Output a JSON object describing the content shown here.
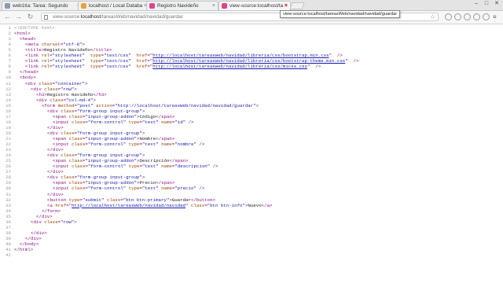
{
  "tabs": [
    {
      "title": "web1tia: Tarea: Segundo",
      "fav_color": "#8e9aa8"
    },
    {
      "title": "localhost / Local Databa",
      "fav_color": "#e8a33c"
    },
    {
      "title": "Registro Navideño",
      "fav_color": "#e0438e"
    },
    {
      "title": "view-source:localhost/ta",
      "fav_color": "#e0438e"
    }
  ],
  "tooltip": "view-source:localhost/tareasWeb/navidad/navidad/guardar",
  "omnibox": {
    "scheme": "view-source:",
    "host": "localhost",
    "path": "/tareasWeb/navidad/navidad/guardar"
  },
  "source_lines": [
    {
      "n": "1",
      "indent": 0,
      "html": "<span class=\"comment\">&lt;!DOCTYPE html&gt;</span>"
    },
    {
      "n": "2",
      "indent": 0,
      "html": "<span class=\"tag\">&lt;html&gt;</span>"
    },
    {
      "n": "3",
      "indent": 1,
      "html": "<span class=\"tag\">&lt;head&gt;</span>"
    },
    {
      "n": "4",
      "indent": 2,
      "html": "<span class=\"tag\">&lt;meta <span class=\"attr\">charset</span>=<span class=\"val\">\"utf-8\"</span>&gt;</span>"
    },
    {
      "n": "5",
      "indent": 2,
      "html": "<span class=\"tag\">&lt;title&gt;</span>Registro Navideño<span class=\"tag\">&lt;/title&gt;</span>"
    },
    {
      "n": "6",
      "indent": 2,
      "html": "<span class=\"tag\">&lt;link <span class=\"attr\">rel</span>=<span class=\"val\">\"stylesheet\"</span>  <span class=\"attr\">type</span>=<span class=\"val\">\"text/css\"</span>  <span class=\"attr\">href</span>=\"<span class=\"link\">http://localhost/tareasWeb/navidad/libreria/css/bootstrap.min.css</span>\"  /&gt;</span>"
    },
    {
      "n": "7",
      "indent": 2,
      "html": "<span class=\"tag\">&lt;link <span class=\"attr\">rel</span>=<span class=\"val\">\"stylesheet\"</span>  <span class=\"attr\">type</span>=<span class=\"val\">\"text/css\"</span>  <span class=\"attr\">href</span>=\"<span class=\"link\">http://localhost/tareasWeb/navidad/libreria/css/bootstrap-theme.min.css</span>\"  /&gt;</span>"
    },
    {
      "n": "8",
      "indent": 2,
      "html": "<span class=\"tag\">&lt;link <span class=\"attr\">rel</span>=<span class=\"val\">\"stylesheet\"</span>  <span class=\"attr\">type</span>=<span class=\"val\">\"text/css\"</span>  <span class=\"attr\">href</span>=\"<span class=\"link\">http://localhost/tareasWeb/navidad/libreria/css/micss.css</span>\"  /&gt;</span>"
    },
    {
      "n": "9",
      "indent": 1,
      "html": "<span class=\"tag\">&lt;/head&gt;</span>"
    },
    {
      "n": "10",
      "indent": 1,
      "html": "<span class=\"tag\">&lt;body&gt;</span>"
    },
    {
      "n": "11",
      "indent": 2,
      "html": "<span class=\"tag\">&lt;div <span class=\"attr\">class</span>=<span class=\"val\">\"container\"</span>&gt;</span>"
    },
    {
      "n": "12",
      "indent": 3,
      "html": "<span class=\"tag\">&lt;div <span class=\"attr\">class</span>=<span class=\"val\">\"row\"</span>&gt;</span>"
    },
    {
      "n": "13",
      "indent": 4,
      "html": "<span class=\"tag\">&lt;h3&gt;</span>Registro Navideño<span class=\"tag\">&lt;/h3&gt;</span>"
    },
    {
      "n": "14",
      "indent": 4,
      "html": "<span class=\"tag\">&lt;div <span class=\"attr\">class</span>=<span class=\"val\">\"col-md-4\"</span>&gt;</span>"
    },
    {
      "n": "15",
      "indent": 5,
      "html": "<span class=\"tag\">&lt;form <span class=\"attr\">method</span>=<span class=\"val\">\"post\"</span> <span class=\"attr\">action</span>=<span class=\"val\">\"http://localhost/tareasWeb/navidad/navidad/guardar\"</span>&gt;</span>"
    },
    {
      "n": "16",
      "indent": 6,
      "html": "<span class=\"tag\">&lt;div <span class=\"attr\">class</span>=<span class=\"val\">\"form-group input-group\"</span>&gt;</span>"
    },
    {
      "n": "17",
      "indent": 7,
      "html": "<span class=\"tag\">&lt;span <span class=\"attr\">class</span>=<span class=\"val\">\"input-group-addon\"</span>&gt;</span>Código<span class=\"tag\">&lt;/span&gt;</span>"
    },
    {
      "n": "18",
      "indent": 7,
      "html": "<span class=\"tag\">&lt;input <span class=\"attr\">class</span>=<span class=\"val\">\"form-control\"</span> <span class=\"attr\">type</span>=<span class=\"val\">\"text\"</span> <span class=\"attr\">name</span>=<span class=\"val\">\"id\"</span> /&gt;</span>"
    },
    {
      "n": "19",
      "indent": 6,
      "html": "<span class=\"tag\">&lt;/div&gt;</span>"
    },
    {
      "n": "20",
      "indent": 6,
      "html": "<span class=\"tag\">&lt;div <span class=\"attr\">class</span>=<span class=\"val\">\"form-group input-group\"</span>&gt;</span>"
    },
    {
      "n": "21",
      "indent": 7,
      "html": "<span class=\"tag\">&lt;span <span class=\"attr\">class</span>=<span class=\"val\">\"input-group-addon\"</span>&gt;</span>Nombre<span class=\"tag\">&lt;/span&gt;</span>"
    },
    {
      "n": "22",
      "indent": 7,
      "html": "<span class=\"tag\">&lt;input <span class=\"attr\">class</span>=<span class=\"val\">\"form-control\"</span> <span class=\"attr\">type</span>=<span class=\"val\">\"text\"</span> <span class=\"attr\">name</span>=<span class=\"val\">\"nombre\"</span> /&gt;</span>"
    },
    {
      "n": "23",
      "indent": 6,
      "html": "<span class=\"tag\">&lt;/div&gt;</span>"
    },
    {
      "n": "24",
      "indent": 6,
      "html": "<span class=\"tag\">&lt;div <span class=\"attr\">class</span>=<span class=\"val\">\"form-group input-group\"</span>&gt;</span>"
    },
    {
      "n": "25",
      "indent": 7,
      "html": "<span class=\"tag\">&lt;span <span class=\"attr\">class</span>=<span class=\"val\">\"input-group-addon\"</span>&gt;</span>Descripción<span class=\"tag\">&lt;/span&gt;</span>"
    },
    {
      "n": "26",
      "indent": 7,
      "html": "<span class=\"tag\">&lt;input <span class=\"attr\">class</span>=<span class=\"val\">\"form-control\"</span> <span class=\"attr\">type</span>=<span class=\"val\">\"text\"</span> <span class=\"attr\">name</span>=<span class=\"val\">\"descripcion\"</span> /&gt;</span>"
    },
    {
      "n": "27",
      "indent": 6,
      "html": "<span class=\"tag\">&lt;/div&gt;</span>"
    },
    {
      "n": "28",
      "indent": 6,
      "html": "<span class=\"tag\">&lt;div <span class=\"attr\">class</span>=<span class=\"val\">\"form-group input-group\"</span>&gt;</span>"
    },
    {
      "n": "29",
      "indent": 7,
      "html": "<span class=\"tag\">&lt;span <span class=\"attr\">class</span>=<span class=\"val\">\"input-group-addon\"</span>&gt;</span>Precio<span class=\"tag\">&lt;/span&gt;</span>"
    },
    {
      "n": "30",
      "indent": 7,
      "html": "<span class=\"tag\">&lt;input <span class=\"attr\">class</span>=<span class=\"val\">\"form-control\"</span> <span class=\"attr\">type</span>=<span class=\"val\">\"text\"</span> <span class=\"attr\">name</span>=<span class=\"val\">\"precio\"</span> /&gt;</span>"
    },
    {
      "n": "31",
      "indent": 6,
      "html": "<span class=\"tag\">&lt;/div&gt;</span>"
    },
    {
      "n": "32",
      "indent": 6,
      "html": "<span class=\"tag\">&lt;button <span class=\"attr\">type</span>=<span class=\"val\">\"submit\"</span> <span class=\"attr\">class</span>=<span class=\"val\">\"btn btn-primary\"</span>&gt;</span>Guardar<span class=\"tag\">&lt;/button&gt;</span>"
    },
    {
      "n": "33",
      "indent": 6,
      "html": "<span class=\"tag\">&lt;a <span class=\"attr\">href</span>=\"<span class=\"link\">http://localhost/tareasWeb/navidad/navidad</span>\" <span class=\"attr\">class</span>=<span class=\"val\">\"btn btn-info\"</span>&gt;</span>Nuevo<span class=\"tag\">&lt;/a&gt;</span>"
    },
    {
      "n": "34",
      "indent": 5,
      "html": "<span class=\"tag\">&lt;/form&gt;</span>"
    },
    {
      "n": "35",
      "indent": 4,
      "html": "<span class=\"tag\">&lt;/div&gt;</span>"
    },
    {
      "n": "36",
      "indent": 3,
      "html": "<span class=\"tag\">&lt;div <span class=\"attr\">class</span>=<span class=\"val\">\"row\"</span>&gt;</span>"
    },
    {
      "n": "37",
      "indent": 0,
      "html": ""
    },
    {
      "n": "38",
      "indent": 3,
      "html": "<span class=\"tag\">&lt;/div&gt;</span>"
    },
    {
      "n": "39",
      "indent": 2,
      "html": "<span class=\"tag\">&lt;/div&gt;</span>"
    },
    {
      "n": "40",
      "indent": 1,
      "html": "<span class=\"tag\">&lt;/body&gt;</span>"
    },
    {
      "n": "41",
      "indent": 0,
      "html": "<span class=\"tag\">&lt;/html&gt;</span>"
    },
    {
      "n": "42",
      "indent": 0,
      "html": ""
    }
  ]
}
